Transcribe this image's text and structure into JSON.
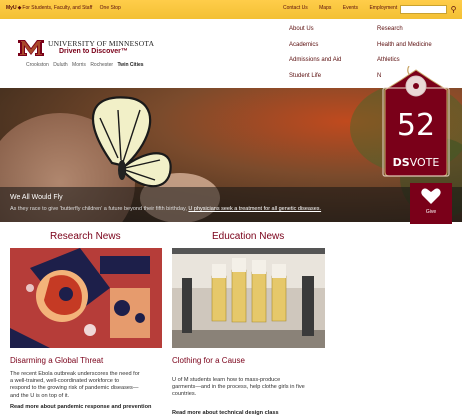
{
  "topbar": {
    "left_links": [
      "For Students, Faculty, and Staff",
      "One Stop"
    ],
    "myu_label": "MyU",
    "right_links": [
      "Contact Us",
      "Maps",
      "Events",
      "Employment"
    ],
    "search_placeholder": ""
  },
  "header": {
    "university_name": "University of Minnesota",
    "tagline": "Driven to Discover",
    "campuses": [
      "Crookston",
      "Duluth",
      "Morris",
      "Rochester",
      "Twin Cities"
    ],
    "active_campus": "Twin Cities"
  },
  "nav": {
    "col1": [
      "About Us",
      "Academics",
      "Admissions and Aid",
      "Student Life"
    ],
    "col2": [
      "Research",
      "Health and Medicine",
      "Athletics",
      "N"
    ]
  },
  "hero": {
    "title": "We All Would Fly",
    "text": "As they race to give 'butterfly children' a future beyond their fifth birthday,",
    "link": "U physicians seek a treatment for all genetic diseases.",
    "give_label": "Give"
  },
  "tag": {
    "number": "52",
    "brand_bold": "DS",
    "brand": "VOTE"
  },
  "news": {
    "research": {
      "heading": "Research News",
      "story_title": "Disarming a Global Threat",
      "story_lines": [
        "The recent Ebola outbreak underscores the need for",
        "a well-trained, well-coordinated workforce to",
        "respond to the growing risk of pandemic diseases—",
        "and the U is on top of it."
      ],
      "more": "Read more about pandemic response and prevention"
    },
    "education": {
      "heading": "Education News",
      "story_title": "Clothing for a Cause",
      "story_lines": [
        "U of M students learn how to mass-produce",
        "garments—and in the process, help clothe girls in five",
        "countries."
      ],
      "more": "Read more about technical design class"
    }
  },
  "colors": {
    "maroon": "#7a0019",
    "gold": "#ffcd4a"
  }
}
